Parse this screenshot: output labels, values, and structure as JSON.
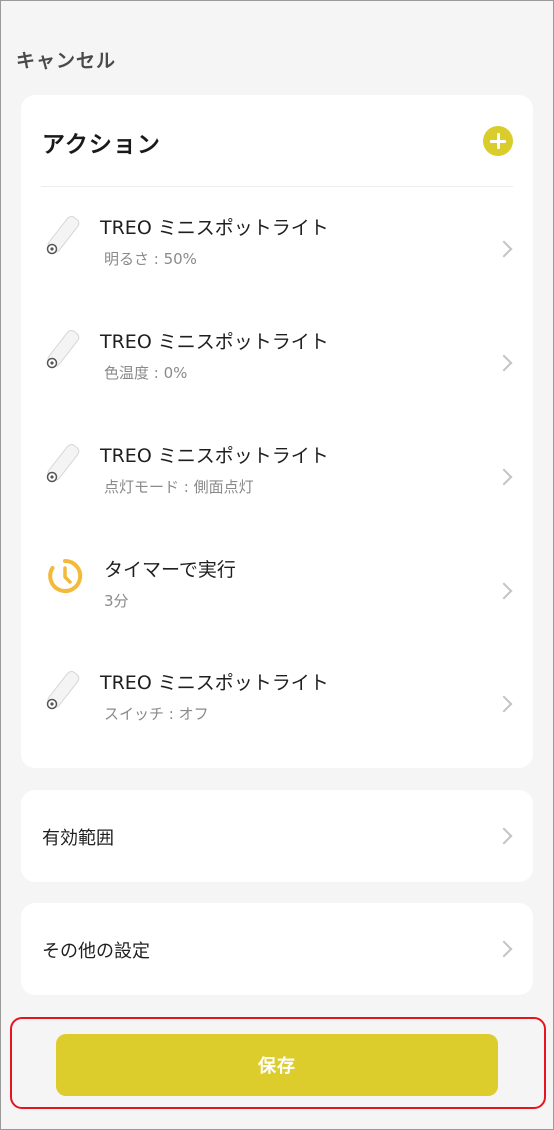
{
  "header": {
    "cancel_label": "キャンセル"
  },
  "actions": {
    "title": "アクション",
    "items": [
      {
        "icon": "spotlight-icon",
        "title": "TREO ミニスポットライト",
        "subtitle": "明るさ : 50%"
      },
      {
        "icon": "spotlight-icon",
        "title": "TREO ミニスポットライト",
        "subtitle": "色温度 : 0%"
      },
      {
        "icon": "spotlight-icon",
        "title": "TREO ミニスポットライト",
        "subtitle": "点灯モード : 側面点灯"
      },
      {
        "icon": "timer-icon",
        "title": "タイマーで実行",
        "subtitle": "3分"
      },
      {
        "icon": "spotlight-icon",
        "title": "TREO ミニスポットライト",
        "subtitle": "スイッチ : オフ"
      }
    ]
  },
  "effective_range": {
    "label": "有効範囲"
  },
  "other_settings": {
    "label": "その他の設定"
  },
  "footer": {
    "save_label": "保存"
  },
  "colors": {
    "accent": "#dccd2d",
    "highlight_outline": "#e6141c",
    "timer": "#f5b93a"
  }
}
